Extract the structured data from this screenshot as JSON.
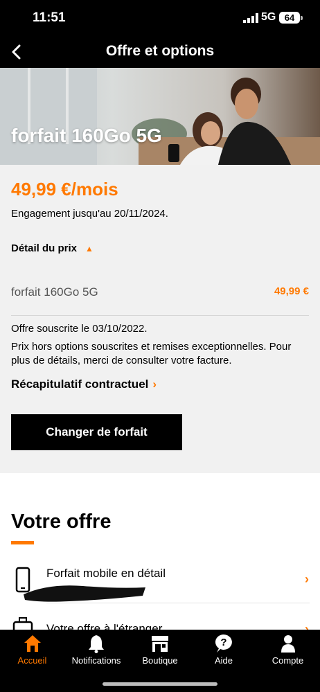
{
  "status": {
    "time": "11:51",
    "network": "5G",
    "battery": "64"
  },
  "nav": {
    "title": "Offre et options"
  },
  "hero": {
    "title": "forfait 160Go 5G"
  },
  "price": {
    "monthly": "49,99 €/mois",
    "engagement": "Engagement jusqu'au 20/11/2024.",
    "detail_label": "Détail du prix",
    "line_name": "forfait 160Go 5G",
    "line_price": "49,99 €",
    "subscribed": "Offre souscrite le 03/10/2022.",
    "note": "Prix hors options souscrites et remises exceptionnelles. Pour plus de détails, merci de consulter votre facture.",
    "recap_label": "Récapitulatif contractuel",
    "change_button": "Changer de forfait"
  },
  "offer": {
    "title": "Votre offre",
    "items": [
      {
        "label": "Forfait mobile en détail",
        "icon": "phone-icon"
      },
      {
        "label": "Votre offre à l'étranger",
        "icon": "suitcase-icon"
      }
    ]
  },
  "tabs": [
    {
      "label": "Accueil",
      "icon": "home-icon",
      "active": true
    },
    {
      "label": "Notifications",
      "icon": "bell-icon",
      "active": false
    },
    {
      "label": "Boutique",
      "icon": "store-icon",
      "active": false
    },
    {
      "label": "Aide",
      "icon": "help-icon",
      "active": false
    },
    {
      "label": "Compte",
      "icon": "user-icon",
      "active": false
    }
  ],
  "colors": {
    "accent": "#ff7900",
    "bar": "#000000",
    "section_bg": "#f1f1f1"
  }
}
